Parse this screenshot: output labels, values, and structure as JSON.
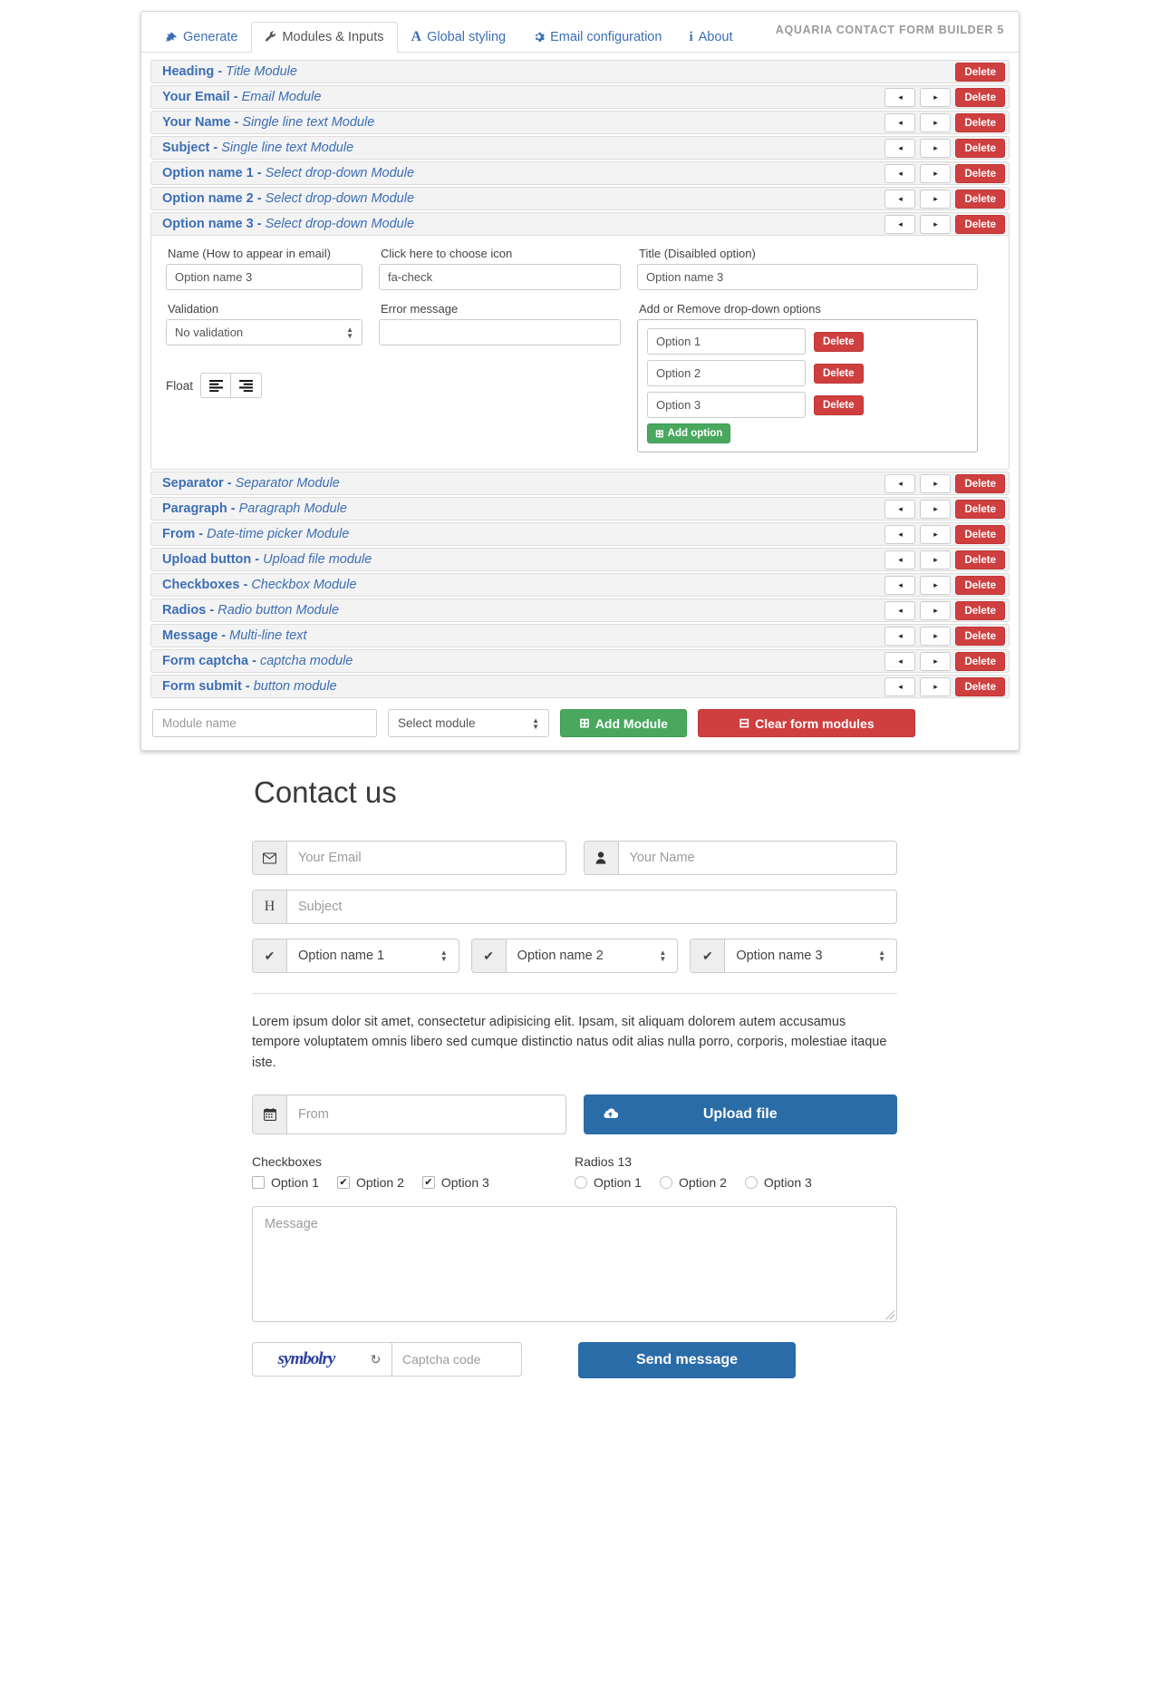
{
  "header": {
    "app_title": "AQUARIA CONTACT FORM BUILDER 5",
    "tabs": [
      {
        "label": "Generate",
        "icon": "plug-icon",
        "active": false
      },
      {
        "label": "Modules & Inputs",
        "icon": "wrench-icon",
        "active": true
      },
      {
        "label": "Global styling",
        "icon": "font-icon",
        "active": false
      },
      {
        "label": "Email configuration",
        "icon": "gear-icon",
        "active": false
      },
      {
        "label": "About",
        "icon": "info-icon",
        "active": false
      }
    ]
  },
  "builder": {
    "delete_label": "Delete",
    "move_left_icon": "arrow-left-icon",
    "move_right_icon": "arrow-right-icon",
    "modules_top": [
      {
        "name": "Heading",
        "type": "Title Module",
        "has_arrows": false
      },
      {
        "name": "Your Email",
        "type": "Email Module",
        "has_arrows": true
      },
      {
        "name": "Your Name",
        "type": "Single line text Module",
        "has_arrows": true
      },
      {
        "name": "Subject",
        "type": "Single line text Module",
        "has_arrows": true
      },
      {
        "name": "Option name 1",
        "type": "Select drop-down Module",
        "has_arrows": true
      },
      {
        "name": "Option name 2",
        "type": "Select drop-down Module",
        "has_arrows": true
      }
    ],
    "expanded_module": {
      "name": "Option name 3",
      "type": "Select drop-down Module",
      "name_label": "Name (How to appear in email)",
      "name_value": "Option name 3",
      "validation_label": "Validation",
      "validation_value": "No validation",
      "icon_label": "Click here to choose icon",
      "icon_value": "fa-check",
      "error_label": "Error message",
      "error_value": "",
      "title_label": "Title (Disaibled option)",
      "title_value": "Option name 3",
      "float_label": "Float",
      "float_left_icon": "align-left-icon",
      "float_right_icon": "align-right-icon",
      "options_label": "Add or Remove drop-down options",
      "options": [
        "Option 1",
        "Option 2",
        "Option 3"
      ],
      "option_delete_label": "Delete",
      "add_option_label": "Add option",
      "add_option_icon": "plus-square-icon"
    },
    "modules_bottom": [
      {
        "name": "Separator",
        "type": "Separator Module",
        "has_arrows": true
      },
      {
        "name": "Paragraph",
        "type": "Paragraph Module",
        "has_arrows": true
      },
      {
        "name": "From",
        "type": "Date-time picker Module",
        "has_arrows": true
      },
      {
        "name": "Upload button",
        "type": "Upload file module",
        "has_arrows": true
      },
      {
        "name": "Checkboxes",
        "type": "Checkbox Module",
        "has_arrows": true
      },
      {
        "name": "Radios",
        "type": "Radio button Module",
        "has_arrows": true
      },
      {
        "name": "Message",
        "type": "Multi-line text",
        "has_arrows": true
      },
      {
        "name": "Form captcha",
        "type": "captcha module",
        "has_arrows": true
      },
      {
        "name": "Form submit",
        "type": "button module",
        "has_arrows": true
      }
    ],
    "bottom_bar": {
      "module_name_placeholder": "Module name",
      "module_name_value": "",
      "select_module_value": "Select module",
      "add_module_label": "Add Module",
      "add_module_icon": "plus-square-icon",
      "clear_label": "Clear form modules",
      "clear_icon": "minus-square-icon"
    }
  },
  "preview": {
    "title": "Contact us",
    "email": {
      "icon": "envelope-icon",
      "placeholder": "Your Email"
    },
    "name": {
      "icon": "user-icon",
      "placeholder": "Your Name"
    },
    "subject": {
      "icon": "heading-icon",
      "icon_glyph": "H",
      "placeholder": "Subject"
    },
    "selects": [
      {
        "icon": "check-icon",
        "value": "Option name 1"
      },
      {
        "icon": "check-icon",
        "value": "Option name 2"
      },
      {
        "icon": "check-icon",
        "value": "Option name 3"
      }
    ],
    "paragraph": "Lorem ipsum dolor sit amet, consectetur adipisicing elit. Ipsam, sit aliquam dolorem autem accusamus tempore voluptatem omnis libero sed cumque distinctio natus odit alias nulla porro, corporis, molestiae itaque iste.",
    "date": {
      "icon": "calendar-icon",
      "placeholder": "From"
    },
    "upload": {
      "icon": "cloud-upload-icon",
      "label": "Upload file"
    },
    "checkboxes": {
      "title": "Checkboxes",
      "items": [
        {
          "label": "Option 1",
          "checked": false
        },
        {
          "label": "Option 2",
          "checked": true
        },
        {
          "label": "Option 3",
          "checked": true
        }
      ]
    },
    "radios": {
      "title": "Radios 13",
      "items": [
        {
          "label": "Option 1",
          "checked": false
        },
        {
          "label": "Option 2",
          "checked": false
        },
        {
          "label": "Option 3",
          "checked": false
        }
      ]
    },
    "message": {
      "placeholder": "Message"
    },
    "captcha": {
      "image_text": "symbolry",
      "reload_icon": "refresh-icon",
      "placeholder": "Captcha code"
    },
    "submit": {
      "label": "Send message"
    }
  },
  "colors": {
    "link_blue": "#3c6eb4",
    "danger_red": "#cf3f3f",
    "success_green": "#49a85e",
    "primary_blue": "#2a6ca8",
    "title_gray": "#9a9a9a"
  }
}
